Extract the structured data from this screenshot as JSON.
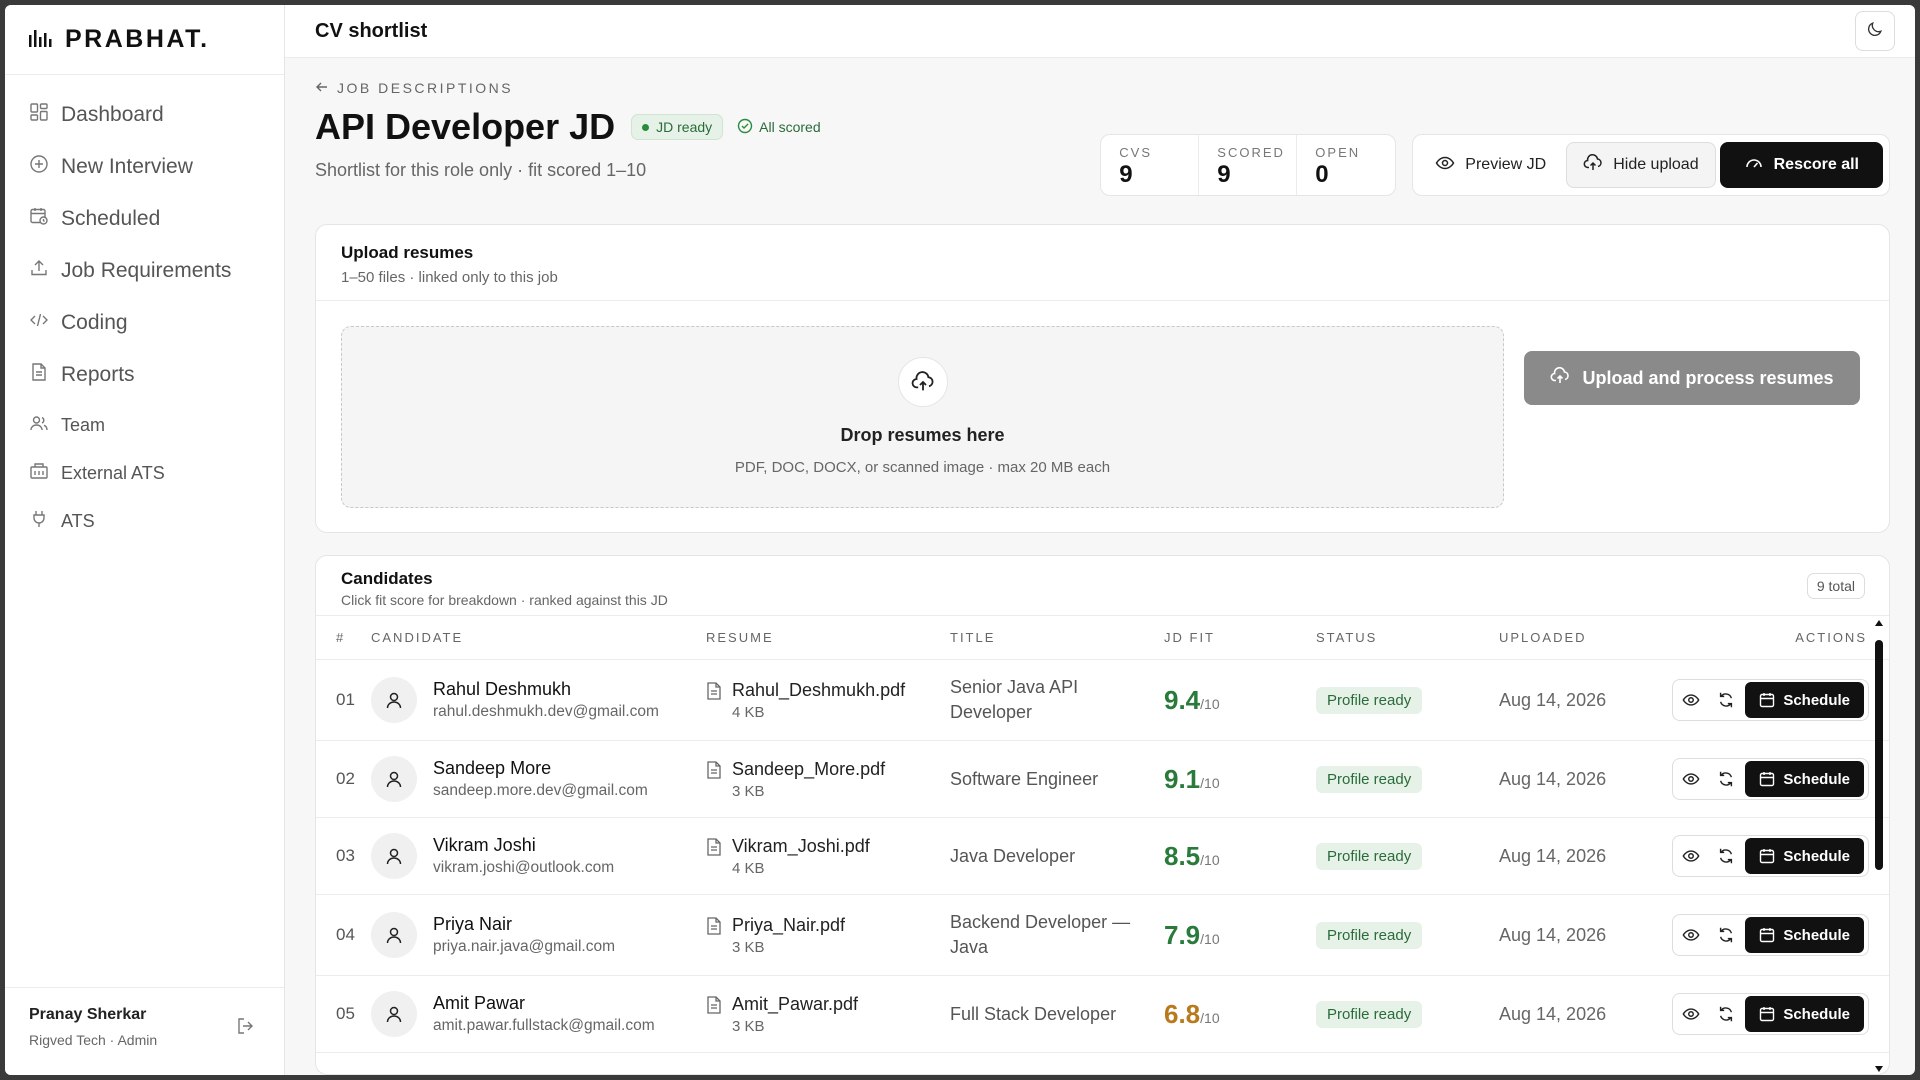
{
  "brand": {
    "name": "PRABHAT",
    "dot": "."
  },
  "sidebar": {
    "items": [
      {
        "label": "Dashboard",
        "icon": "dashboard-icon"
      },
      {
        "label": "New Interview",
        "icon": "plus-circle-icon"
      },
      {
        "label": "Scheduled",
        "icon": "calendar-clock-icon"
      },
      {
        "label": "Job Requirements",
        "icon": "upload-icon"
      },
      {
        "label": "Coding",
        "icon": "code-icon"
      },
      {
        "label": "Reports",
        "icon": "report-icon"
      },
      {
        "label": "Team",
        "icon": "team-icon"
      },
      {
        "label": "External ATS",
        "icon": "building-icon"
      },
      {
        "label": "ATS",
        "icon": "plug-icon"
      }
    ],
    "user": {
      "name": "Pranay Sherkar",
      "role": "Rigved Tech · Admin"
    }
  },
  "topbar": {
    "title": "CV shortlist"
  },
  "header": {
    "back_label": "JOB DESCRIPTIONS",
    "title": "API Developer JD",
    "badge_ready": "JD ready",
    "badge_scored": "All scored",
    "subtitle": "Shortlist for this role only · fit scored 1–10",
    "stats": [
      {
        "label": "CVS",
        "value": "9"
      },
      {
        "label": "SCORED",
        "value": "9"
      },
      {
        "label": "OPEN",
        "value": "0"
      }
    ],
    "preview_label": "Preview JD",
    "hide_upload_label": "Hide upload",
    "rescore_label": "Rescore all"
  },
  "upload": {
    "title": "Upload resumes",
    "subtitle": "1–50 files · linked only to this job",
    "drop_title": "Drop resumes here",
    "drop_sub": "PDF, DOC, DOCX, or scanned image · max 20 MB each",
    "button_label": "Upload and process resumes"
  },
  "candidates": {
    "title": "Candidates",
    "subtitle": "Click fit score for breakdown · ranked against this JD",
    "total_label": "9 total",
    "columns": [
      "#",
      "CANDIDATE",
      "RESUME",
      "TITLE",
      "JD FIT",
      "STATUS",
      "UPLOADED",
      "ACTIONS"
    ],
    "fit_denominator": "/10",
    "schedule_label": "Schedule",
    "rows": [
      {
        "num": "01",
        "name": "Rahul Deshmukh",
        "email": "rahul.deshmukh.dev@gmail.com",
        "file": "Rahul_Deshmukh.pdf",
        "size": "4 KB",
        "title": "Senior Java API Developer",
        "fit": "9.4",
        "fit_color": "#2a7a3c",
        "status": "Profile ready",
        "uploaded": "Aug 14, 2026"
      },
      {
        "num": "02",
        "name": "Sandeep More",
        "email": "sandeep.more.dev@gmail.com",
        "file": "Sandeep_More.pdf",
        "size": "3 KB",
        "title": "Software Engineer",
        "fit": "9.1",
        "fit_color": "#2a7a3c",
        "status": "Profile ready",
        "uploaded": "Aug 14, 2026"
      },
      {
        "num": "03",
        "name": "Vikram Joshi",
        "email": "vikram.joshi@outlook.com",
        "file": "Vikram_Joshi.pdf",
        "size": "4 KB",
        "title": "Java Developer",
        "fit": "8.5",
        "fit_color": "#2a7a3c",
        "status": "Profile ready",
        "uploaded": "Aug 14, 2026"
      },
      {
        "num": "04",
        "name": "Priya Nair",
        "email": "priya.nair.java@gmail.com",
        "file": "Priya_Nair.pdf",
        "size": "3 KB",
        "title": "Backend Developer — Java",
        "fit": "7.9",
        "fit_color": "#2a7a3c",
        "status": "Profile ready",
        "uploaded": "Aug 14, 2026"
      },
      {
        "num": "05",
        "name": "Amit Pawar",
        "email": "amit.pawar.fullstack@gmail.com",
        "file": "Amit_Pawar.pdf",
        "size": "3 KB",
        "title": "Full Stack Developer",
        "fit": "6.8",
        "fit_color": "#b87a1a",
        "status": "Profile ready",
        "uploaded": "Aug 14, 2026"
      }
    ]
  }
}
